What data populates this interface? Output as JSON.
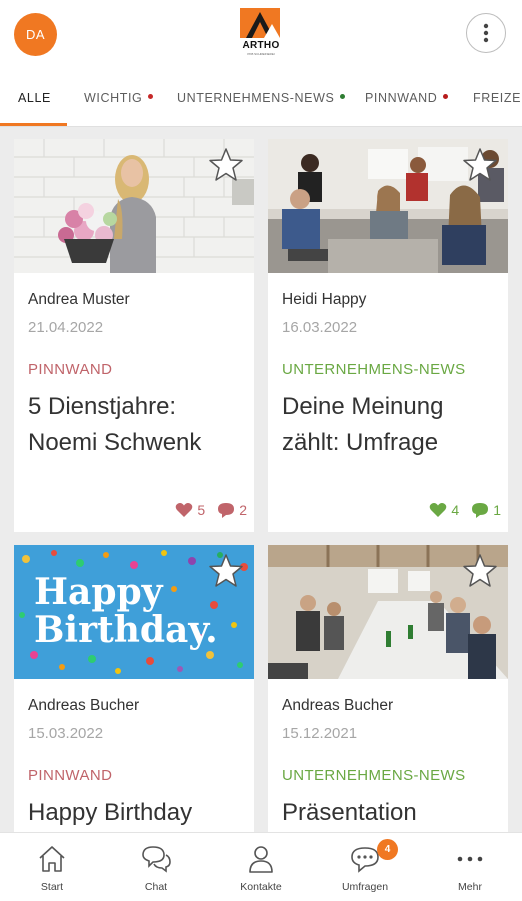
{
  "header": {
    "avatar_initials": "DA",
    "logo_text": "ARTHO",
    "logo_subtext": "PKB SCHREINEREI",
    "more_icon": "more-vertical-icon"
  },
  "tabs": [
    {
      "label": "ALLE",
      "active": true,
      "dot_color": null
    },
    {
      "label": "WICHTIG",
      "active": false,
      "dot_color": "#c62828"
    },
    {
      "label": "UNTERNEHMENS-NEWS",
      "active": false,
      "dot_color": "#2e7d32"
    },
    {
      "label": "PINNWAND",
      "active": false,
      "dot_color": "#b71c1c"
    },
    {
      "label": "FREIZEIT",
      "active": false,
      "dot_color": null
    }
  ],
  "posts": [
    {
      "author": "Andrea Muster",
      "date": "21.04.2022",
      "category": "PINNWAND",
      "category_color": "#c0646a",
      "title_line1": "5 Dienstjahre:",
      "title_line2": "Noemi Schwenk",
      "likes": "5",
      "comments": "2",
      "stats_color": "#c0646a",
      "image": "woman-with-flowers-photo"
    },
    {
      "author": "Heidi Happy",
      "date": "16.03.2022",
      "category": "UNTERNEHMENS-NEWS",
      "category_color": "#6aa843",
      "title_line1": "Deine Meinung",
      "title_line2": "zählt: Umfrage",
      "likes": "4",
      "comments": "1",
      "stats_color": "#6aa843",
      "image": "team-meeting-photo"
    },
    {
      "author": "Andreas Bucher",
      "date": "15.03.2022",
      "category": "PINNWAND",
      "category_color": "#c0646a",
      "title_line1": "Happy Birthday",
      "title_line2": "",
      "image": "happy-birthday-confetti-image",
      "image_text_1": "Happy",
      "image_text_2": "Birthday."
    },
    {
      "author": "Andreas Bucher",
      "date": "15.12.2021",
      "category": "UNTERNEHMENS-NEWS",
      "category_color": "#6aa843",
      "title_line1": "Präsentation",
      "title_line2": "",
      "image": "conference-room-photo"
    }
  ],
  "bottom_nav": [
    {
      "label": "Start",
      "icon": "home-icon"
    },
    {
      "label": "Chat",
      "icon": "chat-icon"
    },
    {
      "label": "Kontakte",
      "icon": "contact-icon"
    },
    {
      "label": "Umfragen",
      "icon": "survey-icon",
      "badge": "4"
    },
    {
      "label": "Mehr",
      "icon": "more-horizontal-icon"
    }
  ],
  "colors": {
    "accent": "#f07822",
    "pinnwand": "#c0646a",
    "news": "#6aa843"
  }
}
